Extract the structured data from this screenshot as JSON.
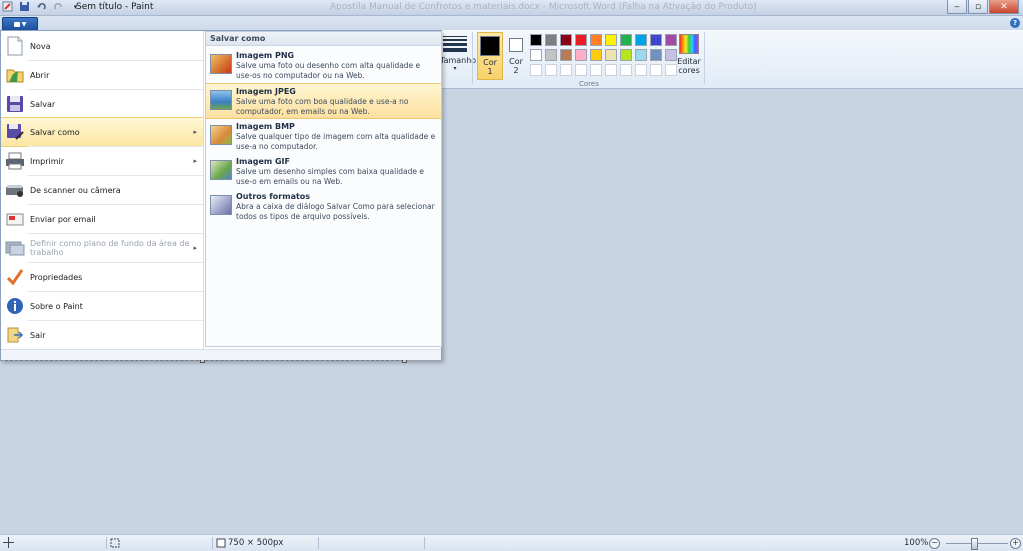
{
  "window": {
    "title": "Sem título - Paint",
    "background_title": "Apostila Manual de Confrotos e materiais.docx - Microsoft Word (Falha na Ativação do Produto)"
  },
  "ribbon": {
    "size_label": "Tamanho",
    "color1_label": "Cor 1",
    "color2_label": "Cor 2",
    "edit_colors_label": "Editar cores",
    "group_colors_label": "Cores",
    "color1": "#000000",
    "color2": "#ffffff",
    "palette": [
      "#000000",
      "#7f7f7f",
      "#880015",
      "#ed1c24",
      "#ff7f27",
      "#fff200",
      "#22b14c",
      "#00a2e8",
      "#3f48cc",
      "#a349a4",
      "#ffffff",
      "#c3c3c3",
      "#b97a57",
      "#ffaec9",
      "#ffc90e",
      "#efe4b0",
      "#b5e61d",
      "#99d9ea",
      "#7092be",
      "#c8bfe7",
      "#ffffff",
      "#ffffff",
      "#ffffff",
      "#ffffff",
      "#ffffff",
      "#ffffff",
      "#ffffff",
      "#ffffff",
      "#ffffff",
      "#ffffff"
    ]
  },
  "app_menu": {
    "items": [
      {
        "label": "Nova",
        "icon": "new-page-icon"
      },
      {
        "label": "Abrir",
        "icon": "open-folder-icon"
      },
      {
        "label": "Salvar",
        "icon": "save-disk-icon"
      },
      {
        "label": "Salvar como",
        "icon": "save-as-icon"
      },
      {
        "label": "Imprimir",
        "icon": "printer-icon"
      },
      {
        "label": "De scanner ou câmera",
        "icon": "scanner-icon"
      },
      {
        "label": "Enviar por email",
        "icon": "email-icon"
      },
      {
        "label": "Definir como plano de fundo da área de trabalho",
        "icon": "desktop-background-icon"
      },
      {
        "label": "Propriedades",
        "icon": "checkmark-icon"
      },
      {
        "label": "Sobre o Paint",
        "icon": "info-icon"
      },
      {
        "label": "Sair",
        "icon": "exit-icon"
      }
    ],
    "save_as": {
      "header": "Salvar como",
      "formats": [
        {
          "name": "Imagem PNG",
          "desc": "Salve uma foto ou desenho com alta qualidade e use-os no computador ou na Web.",
          "color": "#d34a1a"
        },
        {
          "name": "Imagem JPEG",
          "desc": "Salve uma foto com boa qualidade e use-a no computador, em emails ou na Web.",
          "color": "#3c7fc4"
        },
        {
          "name": "Imagem BMP",
          "desc": "Salve qualquer tipo de imagem com alta qualidade e use-a no computador.",
          "color": "#d98a3a"
        },
        {
          "name": "Imagem GIF",
          "desc": "Salve um desenho simples com baixa qualidade e use-o em emails ou na Web.",
          "color": "#6aa64a"
        },
        {
          "name": "Outros formatos",
          "desc": "Abra a caixa de diálogo Salvar Como para selecionar todos os tipos de arquivo possíveis.",
          "color": "#6a6fa8"
        }
      ]
    }
  },
  "status": {
    "dimensions": "750 × 500px",
    "zoom": "100%",
    "zoom_out": "−",
    "zoom_in": "+"
  }
}
